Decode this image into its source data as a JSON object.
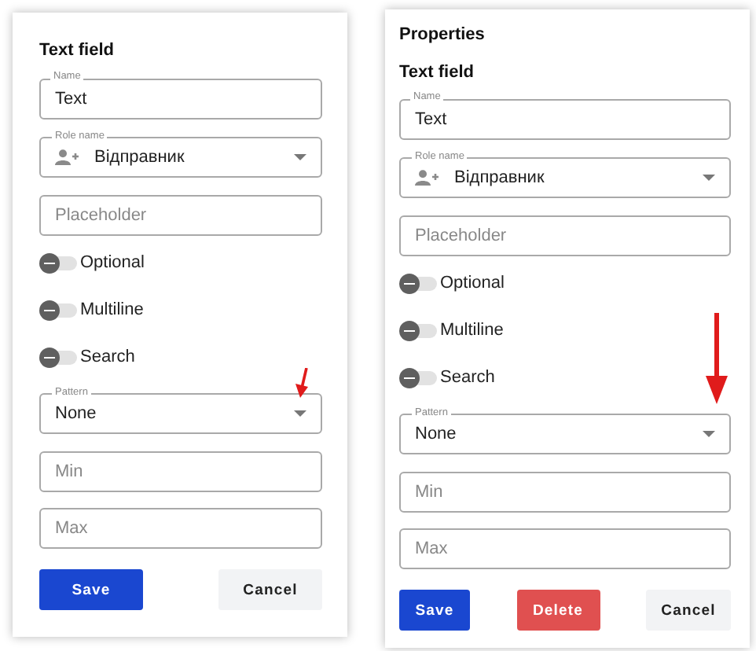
{
  "panels": [
    {
      "kind": "compact",
      "heading": "Text field",
      "fields": [
        {
          "kind": "text",
          "label": "Name",
          "value": "Text"
        },
        {
          "kind": "person_select",
          "label": "Role name",
          "value": "Відправник"
        },
        {
          "kind": "text",
          "placeholder": "Placeholder"
        }
      ],
      "toggles": [
        {
          "label": "Optional",
          "on": false
        },
        {
          "label": "Multiline",
          "on": false
        },
        {
          "label": "Search",
          "on": false
        }
      ],
      "fields_2": [
        {
          "kind": "select",
          "label": "Pattern",
          "value": "None",
          "pointer": true
        },
        {
          "kind": "text",
          "placeholder": "Min"
        },
        {
          "kind": "text",
          "placeholder": "Max"
        }
      ],
      "buttons": [
        {
          "kind": "primary",
          "label": "Save"
        },
        {
          "kind": "secondary",
          "label": "Cancel"
        }
      ]
    },
    {
      "kind": "wide",
      "title": "Properties",
      "heading": "Text field",
      "fields": [
        {
          "kind": "text",
          "label": "Name",
          "value": "Text"
        },
        {
          "kind": "person_select",
          "label": "Role name",
          "value": "Відправник"
        },
        {
          "kind": "text",
          "placeholder": "Placeholder"
        }
      ],
      "toggles": [
        {
          "label": "Optional",
          "on": false
        },
        {
          "label": "Multiline",
          "on": false
        },
        {
          "label": "Search",
          "on": false
        }
      ],
      "fields_2": [
        {
          "kind": "select",
          "label": "Pattern",
          "value": "None",
          "pointer": true
        },
        {
          "kind": "text",
          "placeholder": "Min"
        },
        {
          "kind": "text",
          "placeholder": "Max"
        }
      ],
      "buttons": [
        {
          "kind": "primary",
          "label": "Save"
        },
        {
          "kind": "danger",
          "label": "Delete"
        },
        {
          "kind": "secondary",
          "label": "Cancel"
        }
      ]
    }
  ]
}
